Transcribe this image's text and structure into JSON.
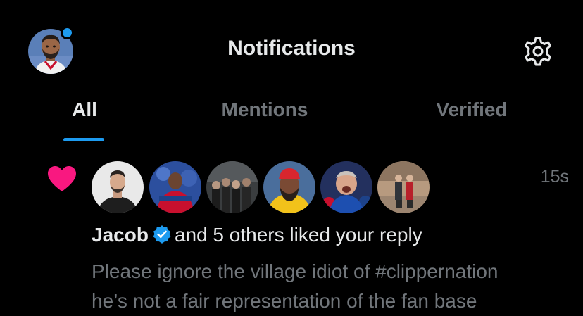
{
  "header": {
    "title": "Notifications",
    "account_avatar": "profile-avatar",
    "unread_dot_color": "#1d9bf0",
    "settings_icon": "gear-icon"
  },
  "tabs": [
    {
      "label": "All",
      "active": true
    },
    {
      "label": "Mentions",
      "active": false
    },
    {
      "label": "Verified",
      "active": false
    }
  ],
  "accent_color": "#1d9bf0",
  "notification": {
    "type_icon": "heart-icon",
    "type_color": "#f91880",
    "time": "15s",
    "actor_name": "Jacob",
    "actor_verified": true,
    "action_text": "and 5 others liked your reply",
    "preview_lines": [
      "Please ignore the village idiot of #clippernation",
      "he’s not a fair representation of the fan base"
    ],
    "liker_avatar_count": 6
  }
}
